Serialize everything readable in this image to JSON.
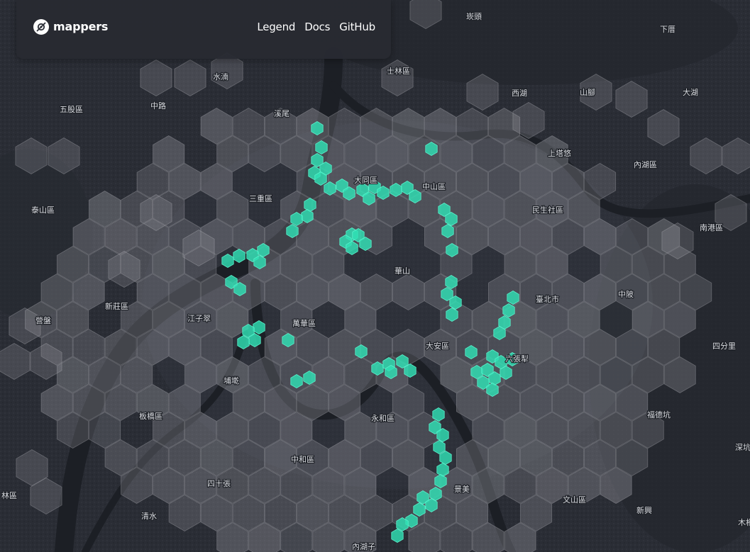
{
  "app": {
    "name": "mappers",
    "logo_icon": "mappers-logo-icon"
  },
  "nav": {
    "links": [
      "Legend",
      "Docs",
      "GitHub"
    ]
  },
  "colors": {
    "map_background": "#2a2d35",
    "river": "#1c1f25",
    "hex_fill": "#9a9ca3",
    "hex_stroke": "#bfc1c6",
    "highlight_fill": "#2fe0b5",
    "highlight_stroke": "#5af2cc",
    "label_text": "#d8dadf"
  },
  "map": {
    "labels": [
      "崁頭",
      "下厝",
      "水湳",
      "士林區",
      "五股區",
      "中路",
      "溪尾",
      "西湖",
      "山腳",
      "大湖",
      "上塔悠",
      "內湖區",
      "大同區",
      "中山區",
      "泰山區",
      "三重區",
      "民生社區",
      "南港區",
      "華山",
      "臺北市",
      "中陂",
      "新莊區",
      "江子翠",
      "萬華區",
      "營盤",
      "大安區",
      "六張犁",
      "四分里",
      "埔墘",
      "永和區",
      "板橋區",
      "福德坑",
      "深坑",
      "中和區",
      "四十張",
      "景美",
      "文山區",
      "林區",
      "清水",
      "新興",
      "內湖子",
      "木柵"
    ]
  }
}
